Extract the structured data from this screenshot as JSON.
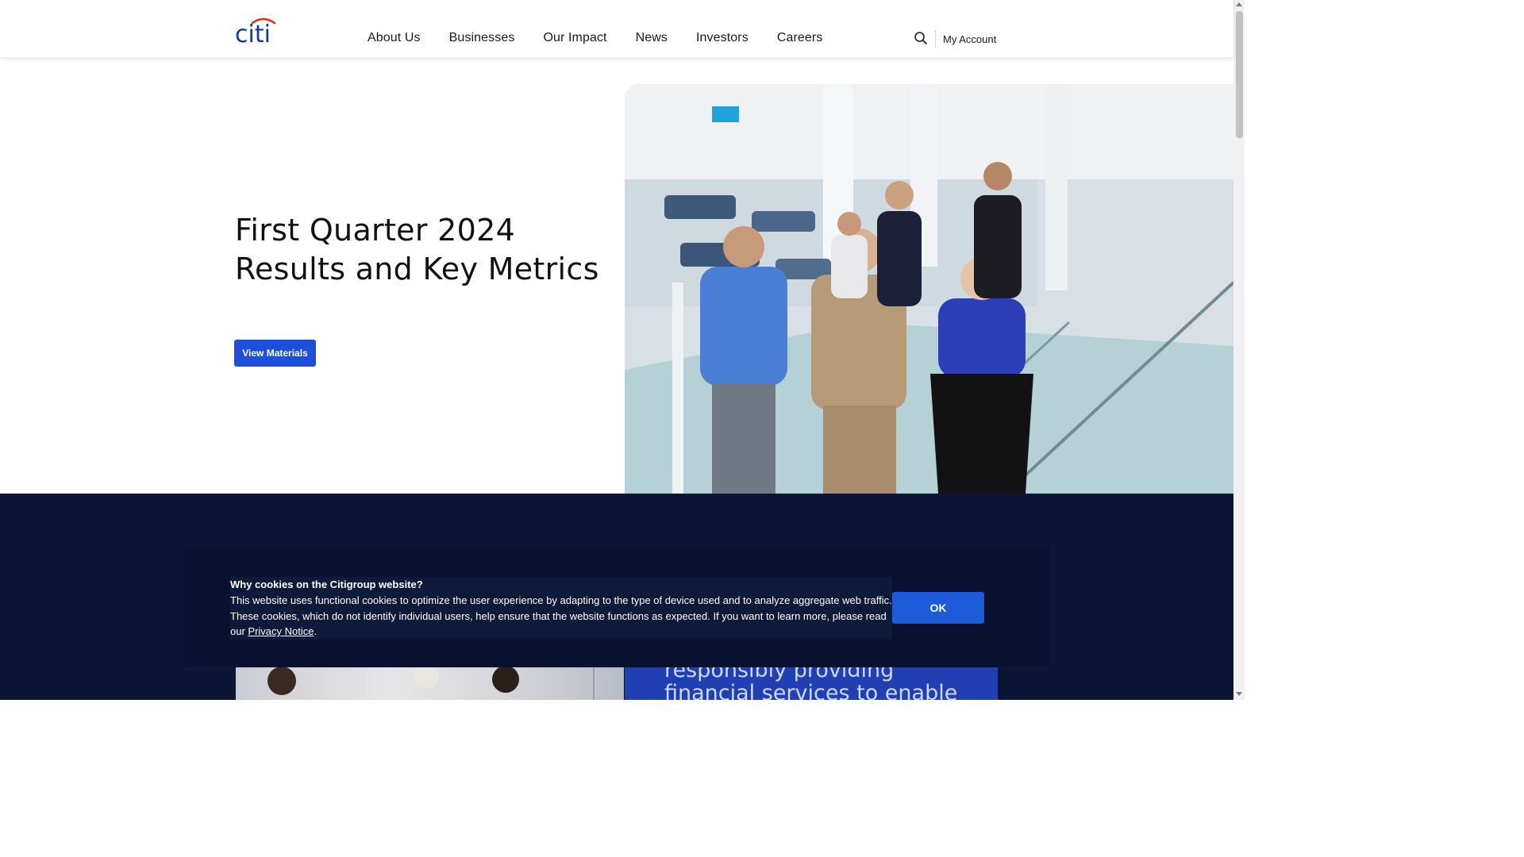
{
  "header": {
    "logo_text": "citi",
    "nav": [
      {
        "label": "About Us"
      },
      {
        "label": "Businesses"
      },
      {
        "label": "Our Impact"
      },
      {
        "label": "News"
      },
      {
        "label": "Investors"
      },
      {
        "label": "Careers"
      }
    ],
    "search_icon": "search-icon",
    "account_label": "My Account"
  },
  "hero": {
    "title": "First Quarter 2024 Results and Key Metrics",
    "cta_label": "View Materials"
  },
  "section": {
    "card_text_line1": "responsibly providing",
    "card_text_line2": "financial services to enable"
  },
  "cookie": {
    "title": "Why cookies on the Citigroup website?",
    "body": "This website uses functional cookies to optimize the user experience by adapting to the type of device used and to analyze aggregate web traffic. These cookies, which do not identify individual users, help ensure that the website functions as expected. If you want to learn more, please read our ",
    "link_label": "Privacy Notice",
    "tail": ".",
    "ok_label": "OK"
  },
  "colors": {
    "brand_blue": "#1d4fd8",
    "logo_blue": "#0f3a9e",
    "logo_red": "#e4322b",
    "dark_navy": "#0b1536",
    "cookie_bg": "#081230",
    "card_blue": "#1f3fb3"
  }
}
